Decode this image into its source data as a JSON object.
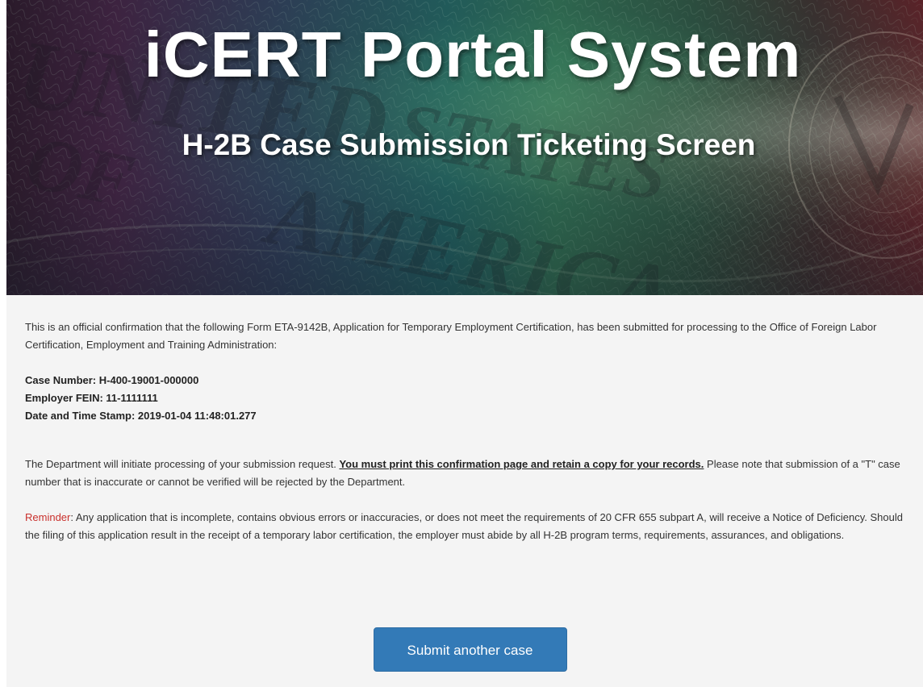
{
  "banner": {
    "title": "iCERT Portal System",
    "subtitle": "H-2B Case Submission Ticketing Screen",
    "background_text": "UNITED STATES OF AMERICA"
  },
  "confirmation": {
    "intro": "This is an official confirmation that the following Form ETA-9142B, Application for Temporary Employment Certification, has been submitted for processing to the Office of Foreign Labor Certification, Employment and Training Administration:",
    "case_number_line": "Case Number: H-400-19001-000000",
    "fein_line": "Employer FEIN: 11-1111111",
    "timestamp_line": "Date and Time Stamp: 2019-01-04 11:48:01.277"
  },
  "department": {
    "text_before": "The Department will initiate processing of your submission request. ",
    "emphasis": "You must print this confirmation page and retain a copy for your records.",
    "text_after": " Please note that submission of a \"T\" case number that is inaccurate or cannot be verified will be rejected by the Department."
  },
  "reminder": {
    "label": "Reminder",
    "text": ": Any application that is incomplete, contains obvious errors or inaccuracies, or does not meet the requirements of 20 CFR 655 subpart A, will receive a Notice of Deficiency. Should the filing of this application result in the receipt of a temporary labor certification, the employer must abide by all H-2B program terms, requirements, assurances, and obligations."
  },
  "actions": {
    "submit_another_label": "Submit another case"
  },
  "colors": {
    "button": "#337ab7",
    "reminder": "#c9302c",
    "content_bg": "#f4f4f4"
  }
}
